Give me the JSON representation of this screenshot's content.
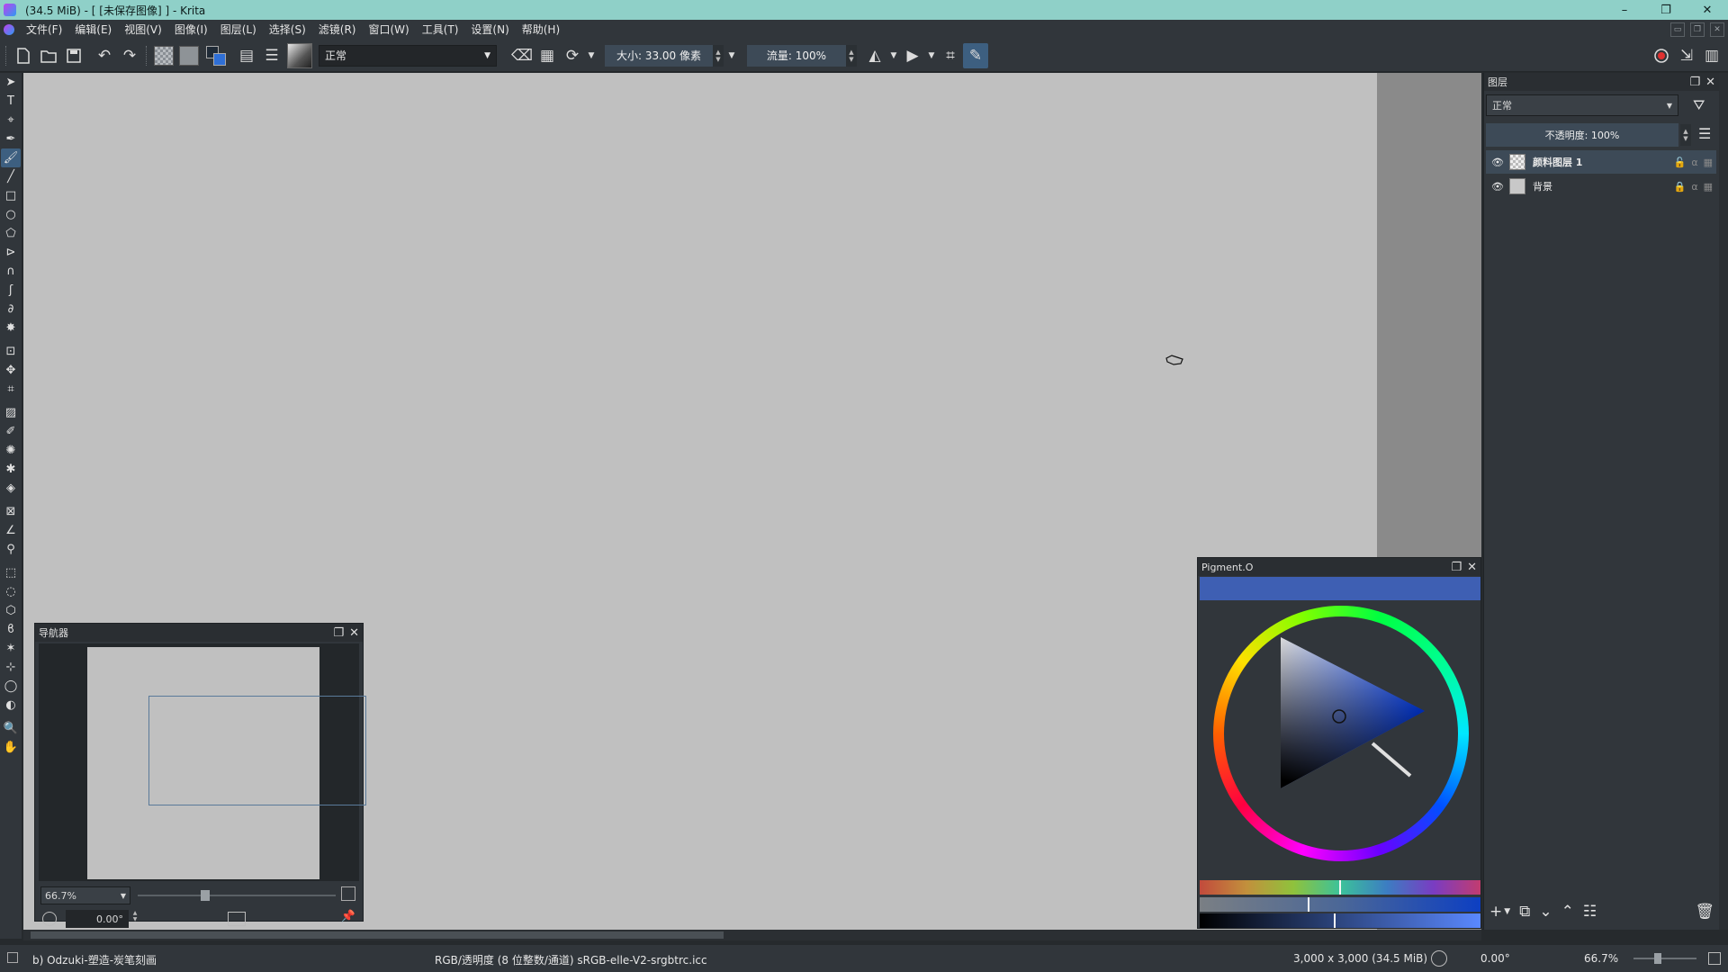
{
  "titlebar": {
    "title": "(34.5 MiB)  - [ [未保存图像] ] - Krita",
    "minimize": "–",
    "restore": "❐",
    "close": "✕"
  },
  "menubar": {
    "items": [
      "文件(F)",
      "编辑(E)",
      "视图(V)",
      "图像(I)",
      "图层(L)",
      "选择(S)",
      "滤镜(R)",
      "窗口(W)",
      "工具(T)",
      "设置(N)",
      "帮助(H)"
    ]
  },
  "toolbar": {
    "blend_mode": "正常",
    "size_label": "大小: 33.00 像素",
    "flow_label": "流量: 100%"
  },
  "navigator": {
    "title": "导航器",
    "zoom": "66.7%",
    "rotation": "0.00°"
  },
  "pigment": {
    "title": "Pigment.O",
    "current_color": "#3e5fb3"
  },
  "layers": {
    "title": "图层",
    "blend_mode": "正常",
    "opacity_label": "不透明度:  100%",
    "items": [
      {
        "name": "颜料图层 1",
        "selected": true
      },
      {
        "name": "背景",
        "selected": false
      }
    ]
  },
  "statusbar": {
    "brush": "b) Odzuki-塑造-炭笔刻画",
    "color_space": "RGB/透明度 (8 位整数/通道)  sRGB-elle-V2-srgbtrc.icc",
    "dimensions": "3,000 x 3,000 (34.5 MiB)",
    "rotation": "0.00°",
    "zoom": "66.7%"
  },
  "colors": {
    "titlebar_bg": "#8fd0c8",
    "ui_bg": "#31363b",
    "canvas_bg": "#c0c0c0",
    "selection_bg": "#3d4a57",
    "foreground_color": "#1f2a36",
    "background_color": "#2f6fd6"
  }
}
